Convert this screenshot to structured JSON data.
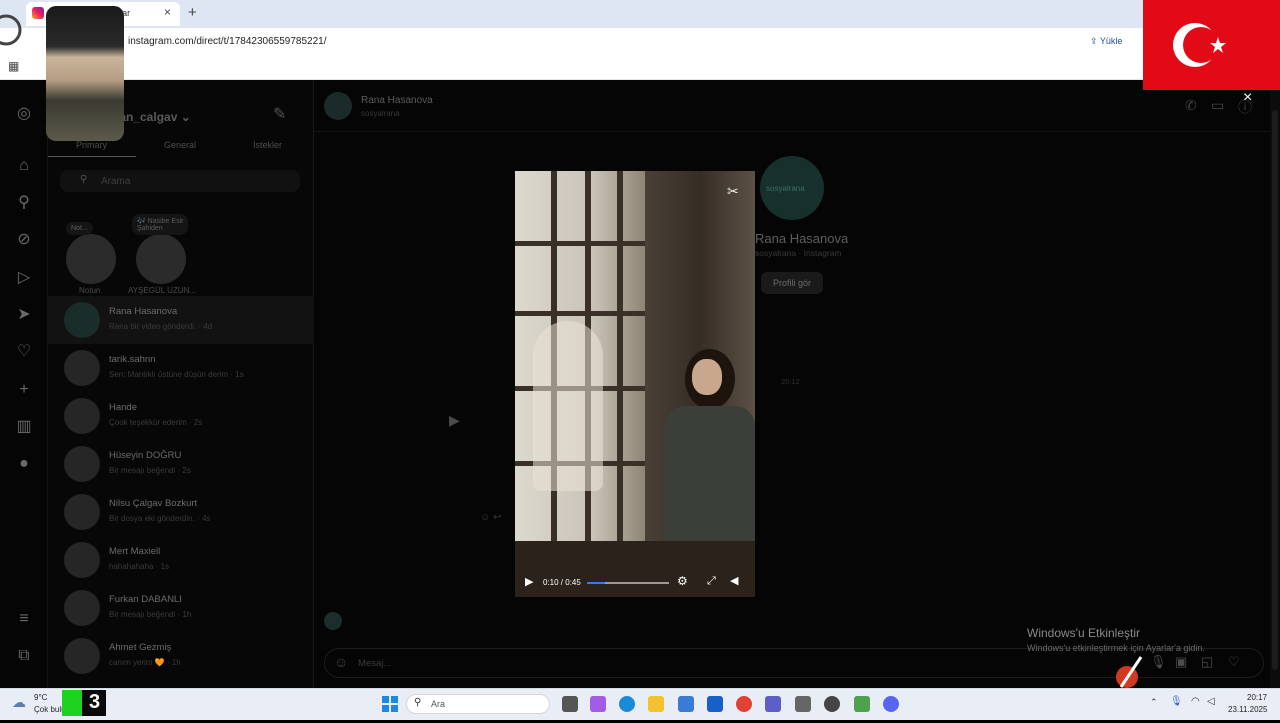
{
  "browser": {
    "tab_title": "Instagram • Mesajlar",
    "tab_close": "×",
    "new_tab": "+",
    "address": "instagram.com/direct/t/17842306559785221/",
    "upload_label": "Yükle"
  },
  "nav_rail": {
    "icons": [
      "instagram-icon",
      "home-icon",
      "search-icon",
      "explore-icon",
      "reels-icon",
      "messages-icon",
      "notifications-icon",
      "create-icon",
      "dashboard-icon",
      "profile-icon",
      "menu-icon",
      "more-icon"
    ]
  },
  "inbox": {
    "username": "...han_calgav",
    "username_chevron": "⌄",
    "tabs": [
      "Primary",
      "General",
      "İstekler"
    ],
    "search_placeholder": "Arama",
    "notes": [
      {
        "bubble": "Not...",
        "name": "Notun"
      },
      {
        "bubble": "🎶 Nasibe Esir\nŞahiden",
        "name": "AYŞEGÜL UZUN..."
      }
    ],
    "conversations": [
      {
        "name": "Rana Hasanova",
        "sub": "Rana bir video gönderdi. · 4d",
        "active": true
      },
      {
        "name": "tarik.sahnn",
        "sub": "Sen: Mantıklı üstüne düşün derim · 1s",
        "active": false
      },
      {
        "name": "Hande",
        "sub": "Çook teşekkür ederim · 2s",
        "active": false
      },
      {
        "name": "Hüseyin DOĞRU",
        "sub": "Bir mesajı beğendi · 2s",
        "active": false
      },
      {
        "name": "Nilsu Çalgav Bozkurt",
        "sub": "Bir dosya eki gönderdin. · 4s",
        "active": false
      },
      {
        "name": "Mert Maxiell",
        "sub": "hahahahaha · 1s",
        "active": false
      },
      {
        "name": "Furkan DABANLI",
        "sub": "Bir mesajı beğendi · 1h",
        "active": false
      },
      {
        "name": "Ahmet Gezmiş",
        "sub": "canım yerim 🧡 · 1h",
        "active": false
      }
    ]
  },
  "chat": {
    "name": "Rana Hasanova",
    "handle": "sosyalrana",
    "profile_avatar_text": "sosyalrana",
    "profile_name": "Rana Hasanova",
    "profile_sub": "sosyalrana · Instagram",
    "profile_button": "Profili gör",
    "timestamp": "20:12",
    "composer_placeholder": "Mesaj...",
    "header_icons": [
      "phone-icon",
      "video-call-icon",
      "info-icon"
    ],
    "composer_icons": [
      "microphone-icon",
      "image-icon",
      "sticker-icon",
      "heart-icon"
    ]
  },
  "video": {
    "time": "0:10 / 0:45",
    "progress": 0.22,
    "close_label": "×"
  },
  "windows": {
    "activate_title": "Windows'u Etkinleştir",
    "activate_sub": "Windows'u etkinleştirmek için Ayarlar'a gidin."
  },
  "taskbar": {
    "weather_temp": "9°C",
    "weather_desc": "Çok bulutlu",
    "k3_text": "3",
    "search_text": "Ara",
    "apps": [
      "task-view-icon",
      "copilot-icon",
      "edge-icon",
      "file-explorer-icon",
      "store-icon",
      "mail-icon",
      "chrome-icon",
      "teams-icon",
      "settings-icon",
      "dev-icon",
      "app-icon",
      "discord-icon"
    ],
    "clock_time": "20:17",
    "clock_date": "23.11.2025"
  },
  "colors": {
    "flag_red": "#e30a17",
    "accent_blue": "#2d7ff9",
    "background": "#050505"
  }
}
